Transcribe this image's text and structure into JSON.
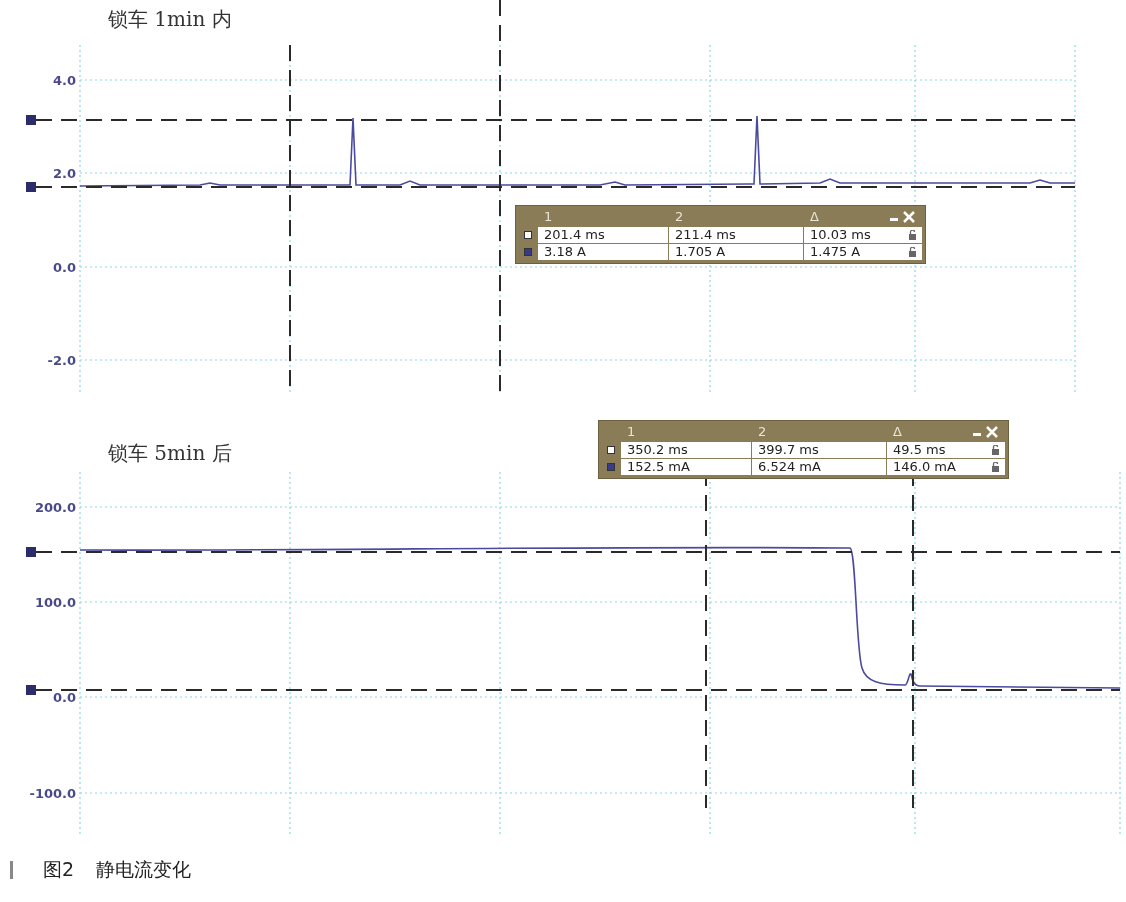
{
  "panels": [
    {
      "title": "锁车 1min 内",
      "y_ticks": [
        "4.0",
        "2.0",
        "0.0",
        "-2.0"
      ],
      "measurements": {
        "headers": [
          "1",
          "2",
          "Δ"
        ],
        "rows": [
          {
            "cells": [
              "201.4 ms",
              "211.4 ms",
              "10.03 ms"
            ]
          },
          {
            "cells": [
              "3.18 A",
              "1.705 A",
              "1.475 A"
            ]
          }
        ]
      }
    },
    {
      "title": "锁车 5min 后",
      "y_ticks": [
        "200.0",
        "100.0",
        "0.0",
        "-100.0"
      ],
      "measurements": {
        "headers": [
          "1",
          "2",
          "Δ"
        ],
        "rows": [
          {
            "cells": [
              "350.2 ms",
              "399.7 ms",
              "49.5 ms"
            ]
          },
          {
            "cells": [
              "152.5 mA",
              "6.524 mA",
              "146.0 mA"
            ]
          }
        ]
      }
    }
  ],
  "caption": {
    "number": "图2",
    "text": "静电流变化"
  }
}
